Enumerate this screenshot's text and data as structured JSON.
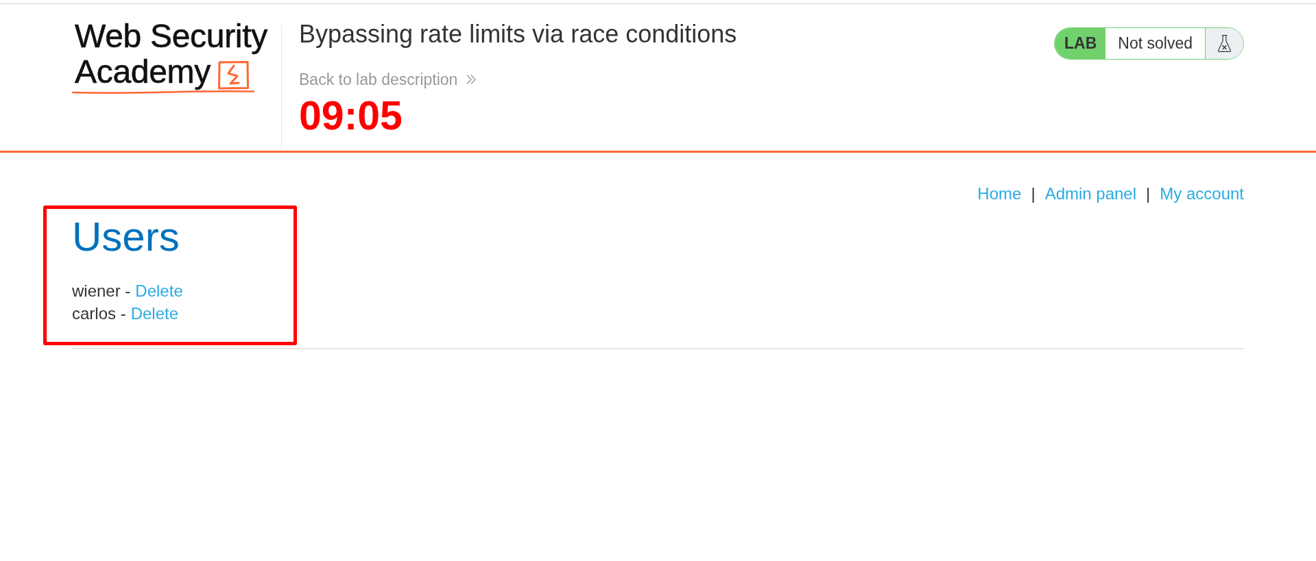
{
  "header": {
    "logo": {
      "lines": [
        "Web Security",
        "Academy"
      ]
    },
    "lab_title": "Bypassing rate limits via race conditions",
    "back_link": {
      "label": "Back to lab description"
    },
    "timer": "09:05",
    "lab_status": {
      "tag": "LAB",
      "status": "Not solved"
    }
  },
  "nav": [
    {
      "kind": "link",
      "label": "Home"
    },
    {
      "kind": "separator",
      "label": "|"
    },
    {
      "kind": "link",
      "label": "Admin panel"
    },
    {
      "kind": "separator",
      "label": "|"
    },
    {
      "kind": "link",
      "label": "My account"
    }
  ],
  "users": {
    "title": "Users",
    "highlighted": true,
    "rows": [
      {
        "label": "wiener -",
        "action": "Delete"
      },
      {
        "label": "carlos -",
        "action": "Delete"
      }
    ]
  }
}
